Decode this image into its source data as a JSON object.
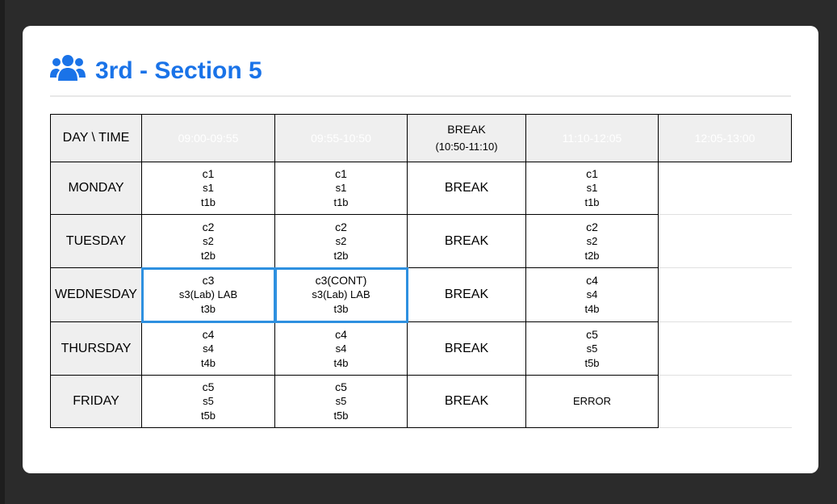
{
  "title": "3rd - Section 5",
  "header": {
    "day_time": "DAY \\ TIME",
    "slot1": "09:00-09:55",
    "slot2": "09:55-10:50",
    "break_label": "BREAK",
    "break_time": "(10:50-11:10)",
    "slot3": "11:10-12:05",
    "slot4": "12:05-13:00"
  },
  "rows": [
    {
      "day": "MONDAY",
      "p1": {
        "c": "c1",
        "s": "s1",
        "t": "t1b"
      },
      "p2": {
        "c": "c1",
        "s": "s1",
        "t": "t1b"
      },
      "brk": "BREAK",
      "p3": {
        "c": "c1",
        "s": "s1",
        "t": "t1b"
      }
    },
    {
      "day": "TUESDAY",
      "p1": {
        "c": "c2",
        "s": "s2",
        "t": "t2b"
      },
      "p2": {
        "c": "c2",
        "s": "s2",
        "t": "t2b"
      },
      "brk": "BREAK",
      "p3": {
        "c": "c2",
        "s": "s2",
        "t": "t2b"
      }
    },
    {
      "day": "WEDNESDAY",
      "p1": {
        "c": "c3",
        "s": "s3(Lab) LAB",
        "t": "t3b"
      },
      "p2": {
        "c": "c3(CONT)",
        "s": "s3(Lab) LAB",
        "t": "t3b"
      },
      "brk": "BREAK",
      "p3": {
        "c": "c4",
        "s": "s4",
        "t": "t4b"
      }
    },
    {
      "day": "THURSDAY",
      "p1": {
        "c": "c4",
        "s": "s4",
        "t": "t4b"
      },
      "p2": {
        "c": "c4",
        "s": "s4",
        "t": "t4b"
      },
      "brk": "BREAK",
      "p3": {
        "c": "c5",
        "s": "s5",
        "t": "t5b"
      }
    },
    {
      "day": "FRIDAY",
      "p1": {
        "c": "c5",
        "s": "s5",
        "t": "t5b"
      },
      "p2": {
        "c": "c5",
        "s": "s5",
        "t": "t5b"
      },
      "brk": "BREAK",
      "p3": {
        "error": "ERROR"
      }
    }
  ],
  "colors": {
    "accent": "#1a73e8",
    "selection": "#2e90e0",
    "header_bg": "#efefef"
  },
  "icons": {
    "title": "users-icon"
  }
}
